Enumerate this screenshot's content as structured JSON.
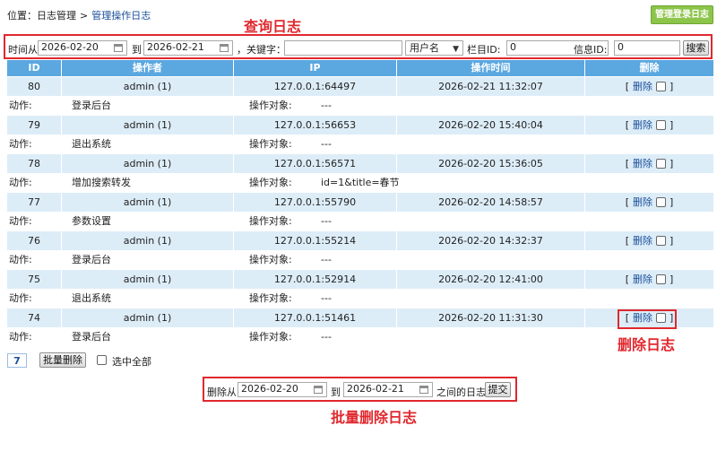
{
  "breadcrumb": {
    "prefix": "位置：",
    "item1": "日志管理",
    "sep": ">",
    "current": "管理操作日志"
  },
  "login_log_button": "管理登录日志",
  "annotations": {
    "query": "查询日志",
    "delete": "删除日志",
    "batch": "批量删除日志",
    "color": "#e0282e"
  },
  "search": {
    "time_from_label": "时间从",
    "date_from": "2026-02-20",
    "to_label": "到",
    "date_to": "2026-02-21",
    "keyword_label": "，关键字：",
    "keyword_value": "",
    "field_select": "用户名",
    "column_id_label": "栏目ID:",
    "column_id_value": "0",
    "info_id_label": "信息ID:",
    "info_id_value": "0",
    "search_button": "搜索"
  },
  "table": {
    "headers": [
      "ID",
      "操作者",
      "IP",
      "操作时间",
      "删除"
    ],
    "action_label": "动作:",
    "target_label": "操作对象:",
    "delete_open": "[",
    "delete_link": "删除",
    "delete_close": "]",
    "rows": [
      {
        "id": "80",
        "operator": "admin (1)",
        "ip": "127.0.0.1:64497",
        "time": "2026-02-21 11:32:07",
        "action": "登录后台",
        "target": "---"
      },
      {
        "id": "79",
        "operator": "admin (1)",
        "ip": "127.0.0.1:56653",
        "time": "2026-02-20 15:40:04",
        "action": "退出系统",
        "target": "---"
      },
      {
        "id": "78",
        "operator": "admin (1)",
        "ip": "127.0.0.1:56571",
        "time": "2026-02-20 15:36:05",
        "action": "增加搜索转发",
        "target": "id=1&title=春节"
      },
      {
        "id": "77",
        "operator": "admin (1)",
        "ip": "127.0.0.1:55790",
        "time": "2026-02-20 14:58:57",
        "action": "参数设置",
        "target": "---"
      },
      {
        "id": "76",
        "operator": "admin (1)",
        "ip": "127.0.0.1:55214",
        "time": "2026-02-20 14:32:37",
        "action": "登录后台",
        "target": "---"
      },
      {
        "id": "75",
        "operator": "admin (1)",
        "ip": "127.0.0.1:52914",
        "time": "2026-02-20 12:41:00",
        "action": "退出系统",
        "target": "---"
      },
      {
        "id": "74",
        "operator": "admin (1)",
        "ip": "127.0.0.1:51461",
        "time": "2026-02-20 11:31:30",
        "action": "登录后台",
        "target": "---"
      }
    ]
  },
  "footer": {
    "count": "7",
    "batch_delete_button": "批量删除",
    "select_all_label": "选中全部"
  },
  "batch": {
    "from_label": "删除从",
    "date_from": "2026-02-20",
    "to_label": "到",
    "date_to": "2026-02-21",
    "between_label": "之间的日志",
    "submit_button": "提交"
  }
}
